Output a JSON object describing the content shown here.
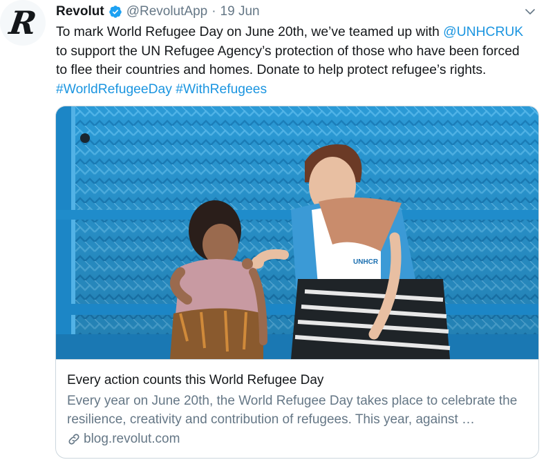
{
  "tweet": {
    "avatar_letter": "R",
    "author_name": "Revolut",
    "handle": "@RevolutApp",
    "separator": "·",
    "date": "19 Jun",
    "text_part1": "To mark World Refugee Day on June 20th, we’ve teamed up with ",
    "mention": "@UNHCRUK",
    "text_part2": " to support the UN Refugee Agency’s protection of those who have been forced to flee their countries and homes. Donate to help protect refugee’s rights. ",
    "hashtag1": "#WorldRefugeeDay",
    "hashtag2": "#WithRefugees",
    "icons": [
      "verified-badge-icon",
      "chevron-down-icon",
      "link-icon"
    ]
  },
  "card": {
    "image_label": "UNHCR",
    "title": "Every action counts this World Refugee Day",
    "description": "Every year on June 20th, the World Refugee Day takes place to celebrate the resilience, creativity and contribution of refugees. This year, against …",
    "domain": "blog.revolut.com"
  },
  "colors": {
    "link": "#1b95e0",
    "secondary_text": "#657786",
    "primary_text": "#14171a",
    "border": "#ccd6dd",
    "wall_blue": "#2b9ad6"
  }
}
